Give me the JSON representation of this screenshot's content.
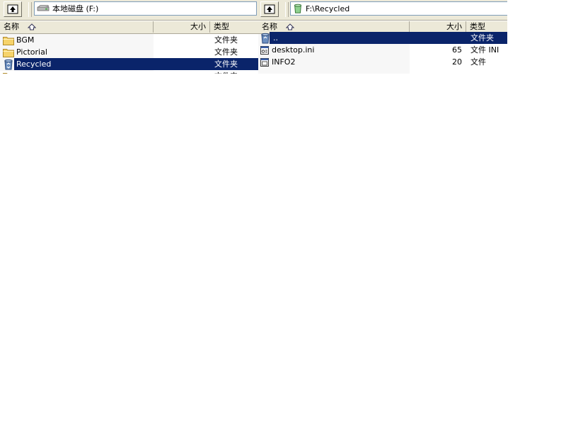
{
  "left_pane": {
    "path": "本地磁盘 (F:)",
    "columns": {
      "name": "名称",
      "size": "大小",
      "type": "类型"
    },
    "rows": [
      {
        "name": "BGM",
        "size": "",
        "type": "文件夹"
      },
      {
        "name": "Pictorial",
        "size": "",
        "type": "文件夹"
      },
      {
        "name": "Recycled",
        "size": "",
        "type": "文件夹"
      },
      {
        "name": "...",
        "size": "",
        "type": "文件夹"
      }
    ],
    "selected_index": 2
  },
  "right_pane": {
    "path": "F:\\Recycled",
    "columns": {
      "name": "名称",
      "size": "大小",
      "type": "类型"
    },
    "rows": [
      {
        "name": "..",
        "size": "",
        "type": "文件夹"
      },
      {
        "name": "desktop.ini",
        "size": "65",
        "type": "文件 INI"
      },
      {
        "name": "INFO2",
        "size": "20",
        "type": "文件"
      }
    ],
    "selected_index": 0
  },
  "colors": {
    "selection": "#0a246a",
    "chrome": "#ece9d8",
    "folder": "#f6d36b"
  }
}
